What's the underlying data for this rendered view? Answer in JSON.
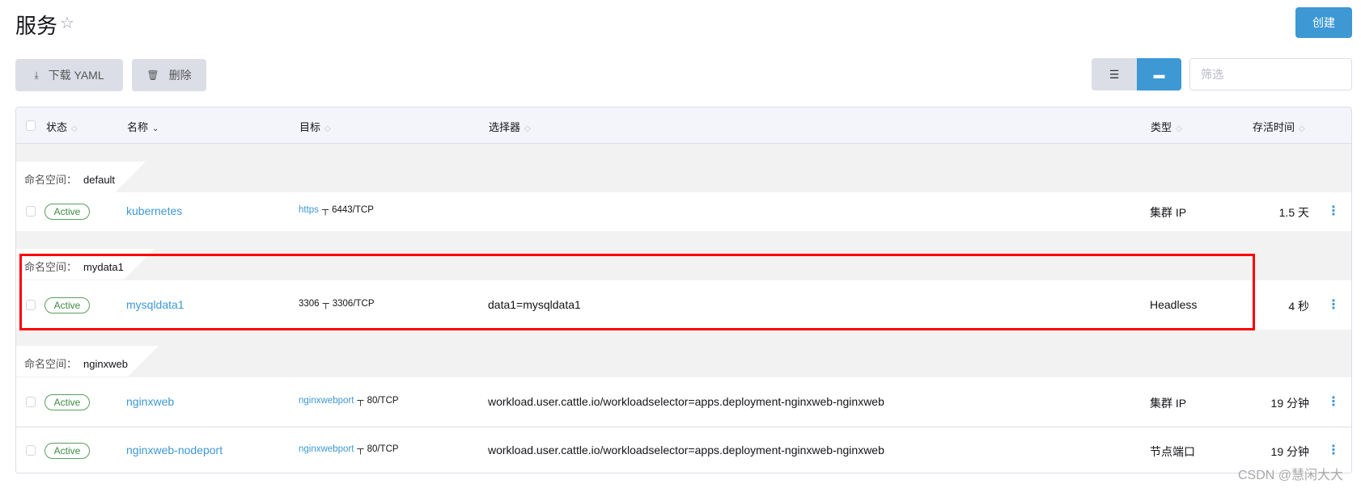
{
  "header": {
    "title": "服务",
    "star_icon": "star-outline",
    "create_label": "创建"
  },
  "toolbar": {
    "download_label": "下载 YAML",
    "delete_label": "删除",
    "filter_placeholder": "筛选",
    "view_mode": "group-by-namespace"
  },
  "table": {
    "columns": [
      "状态",
      "名称",
      "目标",
      "选择器",
      "类型",
      "存活时间"
    ],
    "groups": [
      {
        "ns_label": "命名空间：",
        "namespace": "default",
        "rows": [
          {
            "status": "Active",
            "name": "kubernetes",
            "port_name": "https",
            "target": "6443/TCP",
            "selector": "",
            "type": "集群 IP",
            "age": "1.5 天"
          }
        ]
      },
      {
        "ns_label": "命名空间：",
        "namespace": "mydata1",
        "rows": [
          {
            "status": "Active",
            "name": "mysqldata1",
            "port_name": "3306",
            "target": "3306/TCP",
            "selector": "data1=mysqldata1",
            "type": "Headless",
            "age": "4 秒"
          }
        ]
      },
      {
        "ns_label": "命名空间：",
        "namespace": "nginxweb",
        "rows": [
          {
            "status": "Active",
            "name": "nginxweb",
            "port_name": "nginxwebport",
            "target": "80/TCP",
            "selector": "workload.user.cattle.io/workloadselector=apps.deployment-nginxweb-nginxweb",
            "type": "集群 IP",
            "age": "19 分钟"
          },
          {
            "status": "Active",
            "name": "nginxweb-nodeport",
            "port_name": "nginxwebport",
            "target": "80/TCP",
            "selector": "workload.user.cattle.io/workloadselector=apps.deployment-nginxweb-nginxweb",
            "type": "节点端口",
            "age": "19 分钟"
          }
        ]
      }
    ]
  },
  "colors": {
    "accent": "#3d98d3",
    "active": "#3d8a43",
    "highlight": "#ff0000"
  },
  "watermark": "CSDN @慧闲大大"
}
